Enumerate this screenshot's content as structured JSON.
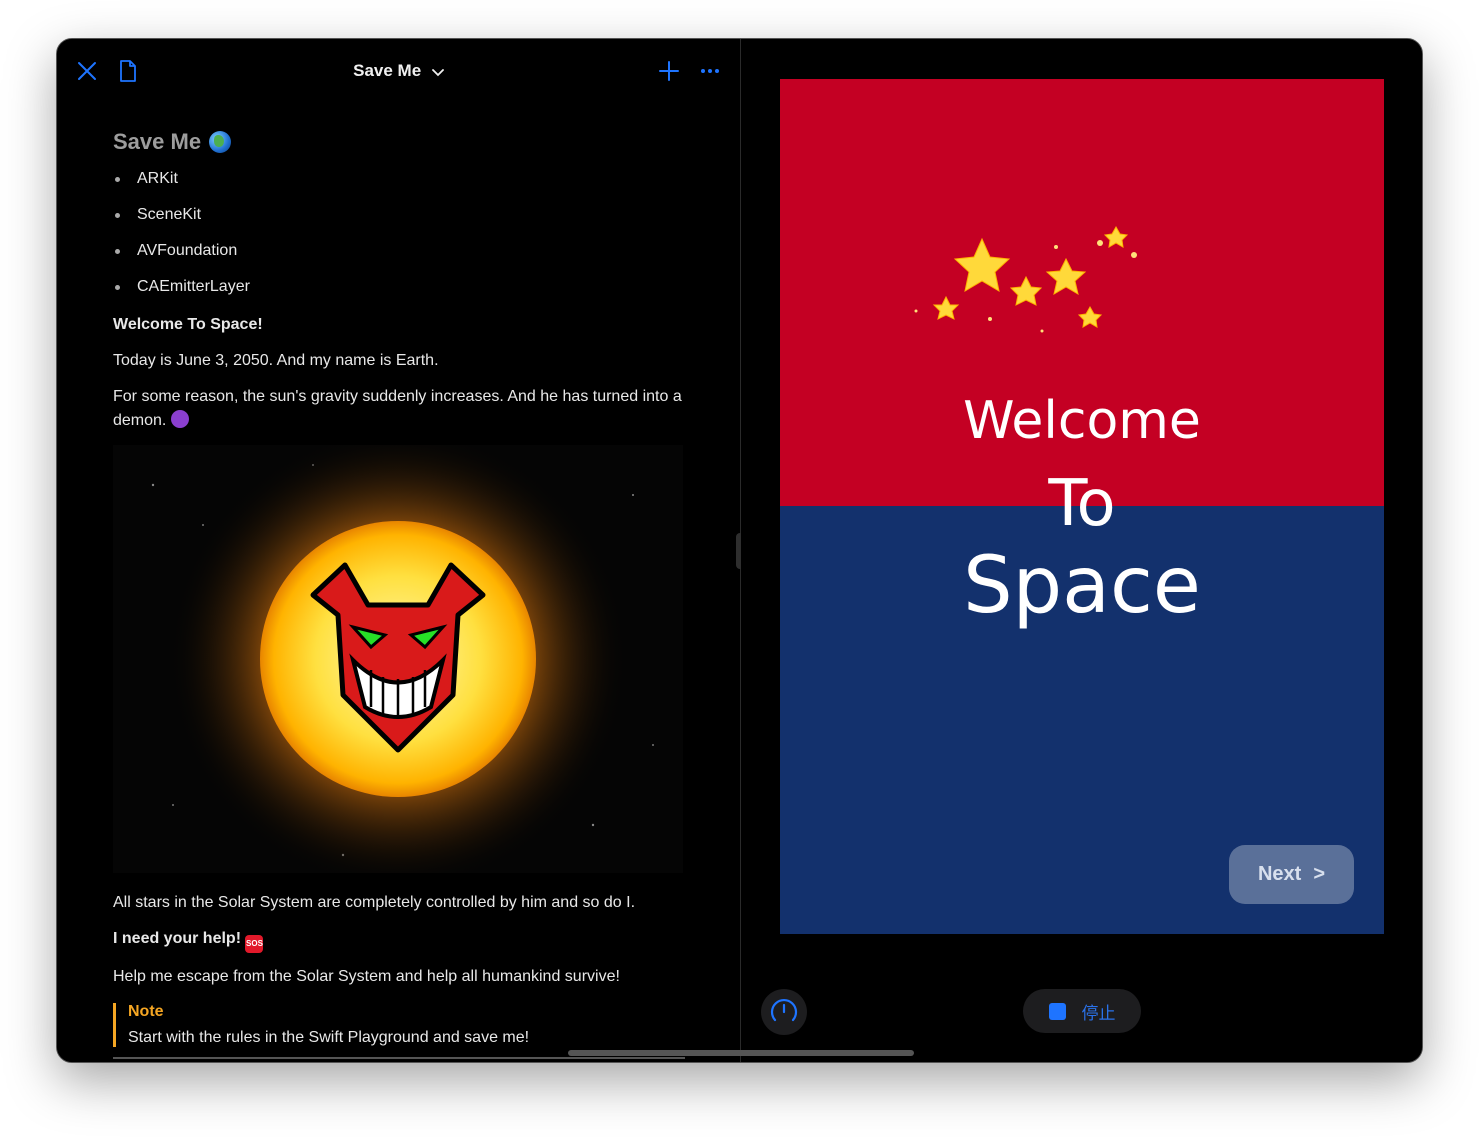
{
  "toolbar": {
    "title": "Save Me",
    "close_icon": "close-icon",
    "document_icon": "document-icon",
    "add_icon": "plus-icon",
    "more_icon": "ellipsis-icon"
  },
  "document": {
    "heading": "Save Me",
    "bullets": [
      "ARKit",
      "SceneKit",
      "AVFoundation",
      "CAEmitterLayer"
    ],
    "welcome": "Welcome To Space!",
    "date_line": "Today is June 3, 2050. And my name is Earth.",
    "sun_line": "For some reason, the sun's gravity suddenly increases. And he has turned into a demon.",
    "stars_line": "All stars in the Solar System are completely controlled by him and so do I.",
    "help_line": "I need your help!",
    "sos_label": "SOS",
    "escape_line": "Help me escape from the Solar System and help all humankind survive!",
    "note_title": "Note",
    "note_text": "Start with the rules in the Swift Playground and save me!"
  },
  "preview": {
    "line1": "Welcome",
    "line2": "To",
    "line3": "Space",
    "next_label": "Next",
    "next_chevron": ">",
    "stop_label": "停止"
  },
  "colors": {
    "accent": "#1e74ff",
    "note": "#f5a623",
    "red_panel": "#c40023",
    "blue_panel": "#13316d"
  }
}
